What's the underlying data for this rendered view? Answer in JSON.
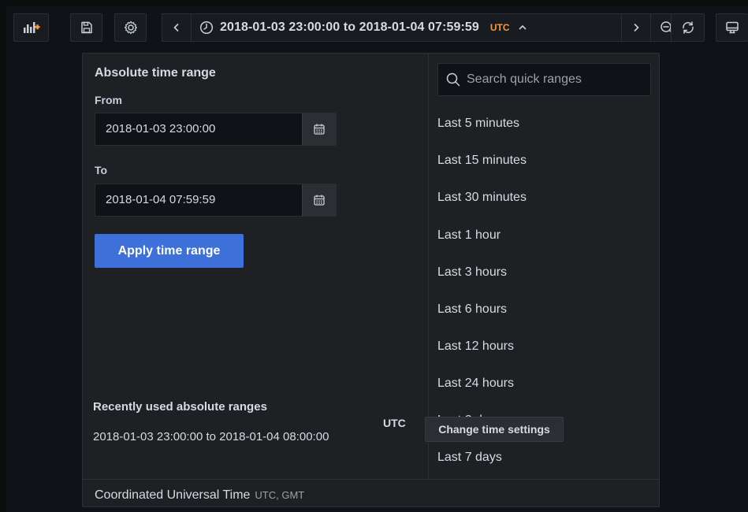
{
  "toolbar": {
    "time_range_text": "2018-01-03 23:00:00 to 2018-01-04 07:59:59",
    "timezone_badge": "UTC"
  },
  "picker": {
    "title": "Absolute time range",
    "from_label": "From",
    "from_value": "2018-01-03 23:00:00",
    "to_label": "To",
    "to_value": "2018-01-04 07:59:59",
    "apply_label": "Apply time range",
    "recent_title": "Recently used absolute ranges",
    "recent_items": [
      "2018-01-03 23:00:00 to 2018-01-04 08:00:00"
    ],
    "search_placeholder": "Search quick ranges",
    "quick_ranges": [
      "Last 5 minutes",
      "Last 15 minutes",
      "Last 30 minutes",
      "Last 1 hour",
      "Last 3 hours",
      "Last 6 hours",
      "Last 12 hours",
      "Last 24 hours",
      "Last 2 days",
      "Last 7 days"
    ],
    "footer": {
      "tz_name": "Coordinated Universal Time",
      "tz_abbr": "UTC, GMT",
      "tz_badge": "UTC",
      "change_label": "Change time settings"
    }
  },
  "colors": {
    "accent_orange": "#ff9830",
    "primary_blue": "#3d71d9",
    "panel_bg": "#1f2024",
    "page_bg": "#111217"
  },
  "icons": [
    "add-panel-icon",
    "save-icon",
    "gear-icon",
    "chevron-left-icon",
    "clock-icon",
    "chevron-up-icon",
    "chevron-right-icon",
    "zoom-out-icon",
    "refresh-icon",
    "tv-icon",
    "calendar-icon",
    "search-icon"
  ]
}
